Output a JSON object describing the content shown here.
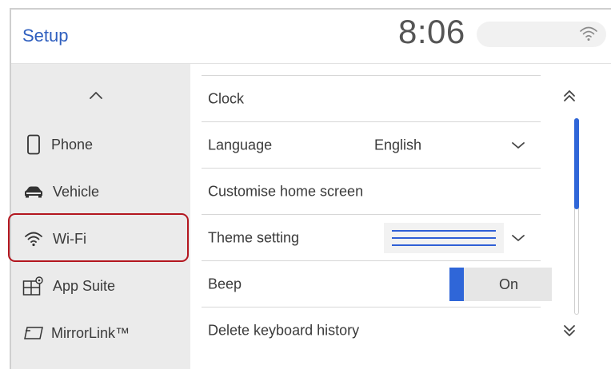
{
  "header": {
    "title": "Setup",
    "clock": "8:06",
    "status_icon": "wifi-signal-icon"
  },
  "sidebar": {
    "scroll_up_icon": "chevron-up-icon",
    "items": [
      {
        "label": "Phone",
        "icon": "phone-icon"
      },
      {
        "label": "Vehicle",
        "icon": "car-icon"
      },
      {
        "label": "Wi-Fi",
        "icon": "wifi-icon",
        "selected": true
      },
      {
        "label": "App Suite",
        "icon": "app-suite-icon"
      },
      {
        "label": "MirrorLink™",
        "icon": "mirrorlink-icon"
      }
    ]
  },
  "settings": {
    "rows": [
      {
        "label": "Clock"
      },
      {
        "label": "Language",
        "value": "English",
        "control": "dropdown"
      },
      {
        "label": "Customise home screen"
      },
      {
        "label": "Theme setting",
        "control": "dropdown"
      },
      {
        "label": "Beep",
        "control": "toggle",
        "toggle_label": "On"
      },
      {
        "label": "Delete keyboard history"
      }
    ]
  },
  "scrollbar": {
    "up_icon": "double-chevron-up-icon",
    "down_icon": "double-chevron-down-icon",
    "position": 0.0,
    "visible_fraction": 0.46
  },
  "colors": {
    "accent": "#2f66d8",
    "title": "#2f5fbf",
    "selection_border": "#b3161f",
    "sidebar_bg": "#ebebeb"
  }
}
